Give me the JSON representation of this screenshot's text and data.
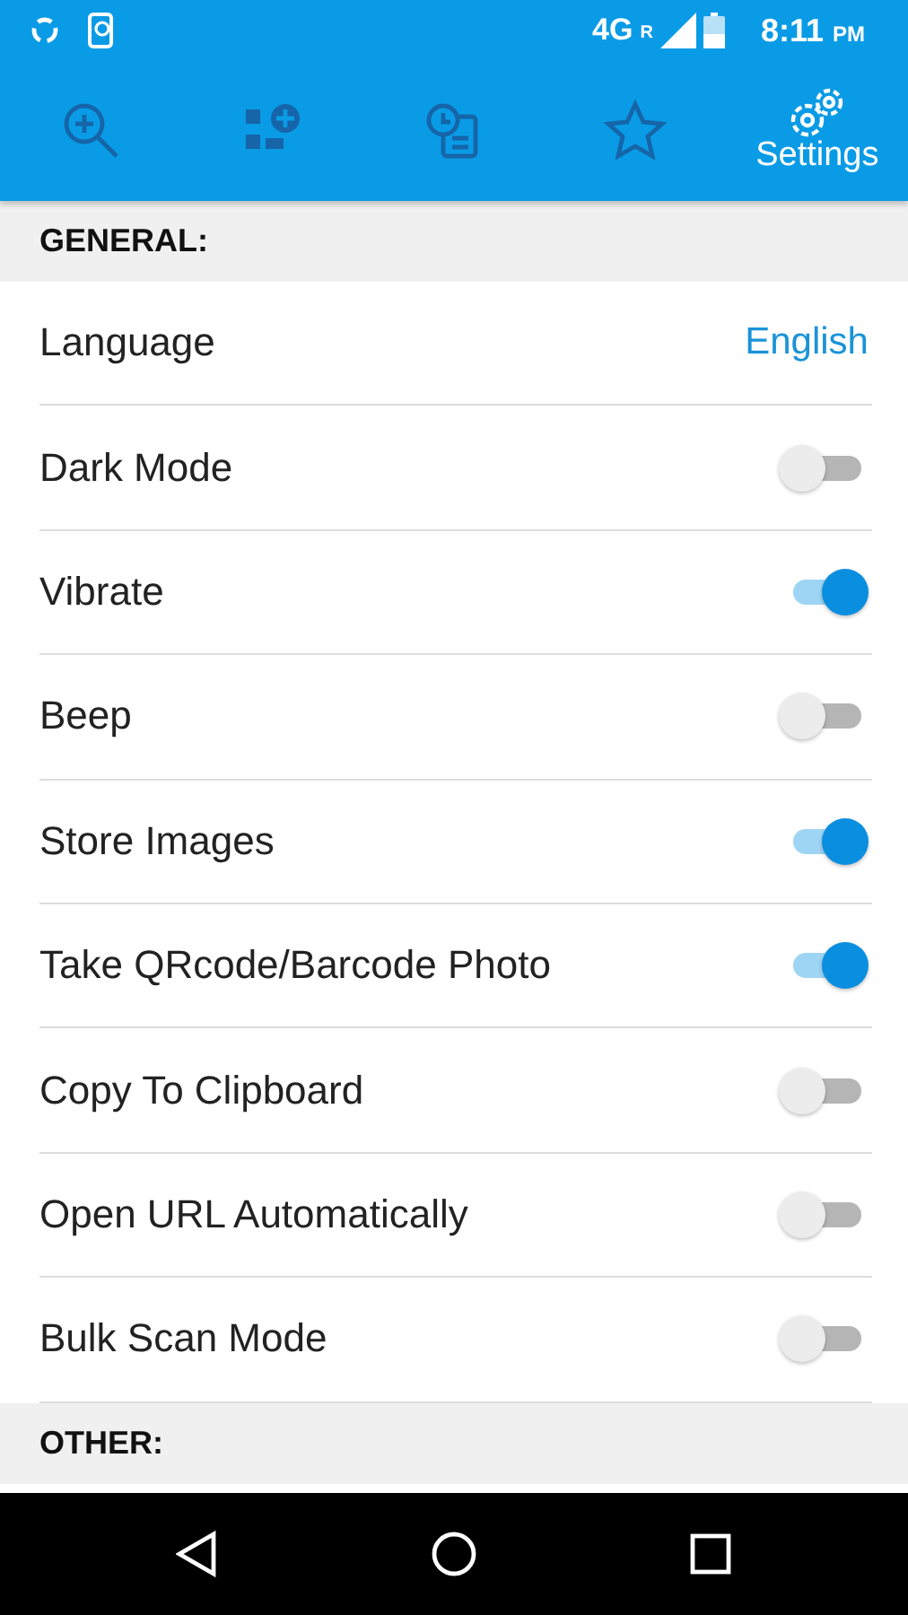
{
  "status_bar": {
    "network": "4G",
    "roaming": "R",
    "time": "8:11",
    "ampm": "PM"
  },
  "tabs": [
    {
      "kind": "scan",
      "selected": false
    },
    {
      "kind": "create",
      "selected": false
    },
    {
      "kind": "history",
      "selected": false
    },
    {
      "kind": "favorites",
      "selected": false
    },
    {
      "kind": "settings",
      "label": "Settings",
      "selected": true
    }
  ],
  "sections": [
    {
      "title": "GENERAL:",
      "rows": [
        {
          "kind": "value",
          "label": "Language",
          "value": "English"
        },
        {
          "kind": "toggle",
          "label": "Dark Mode",
          "on": false
        },
        {
          "kind": "toggle",
          "label": "Vibrate",
          "on": true
        },
        {
          "kind": "toggle",
          "label": "Beep",
          "on": false
        },
        {
          "kind": "toggle",
          "label": "Store Images",
          "on": true
        },
        {
          "kind": "toggle",
          "label": "Take QRcode/Barcode Photo",
          "on": true
        },
        {
          "kind": "toggle",
          "label": "Copy To Clipboard",
          "on": false
        },
        {
          "kind": "toggle",
          "label": "Open URL Automatically",
          "on": false
        },
        {
          "kind": "toggle",
          "label": "Bulk Scan Mode",
          "on": false
        }
      ]
    },
    {
      "title": "OTHER:"
    }
  ]
}
